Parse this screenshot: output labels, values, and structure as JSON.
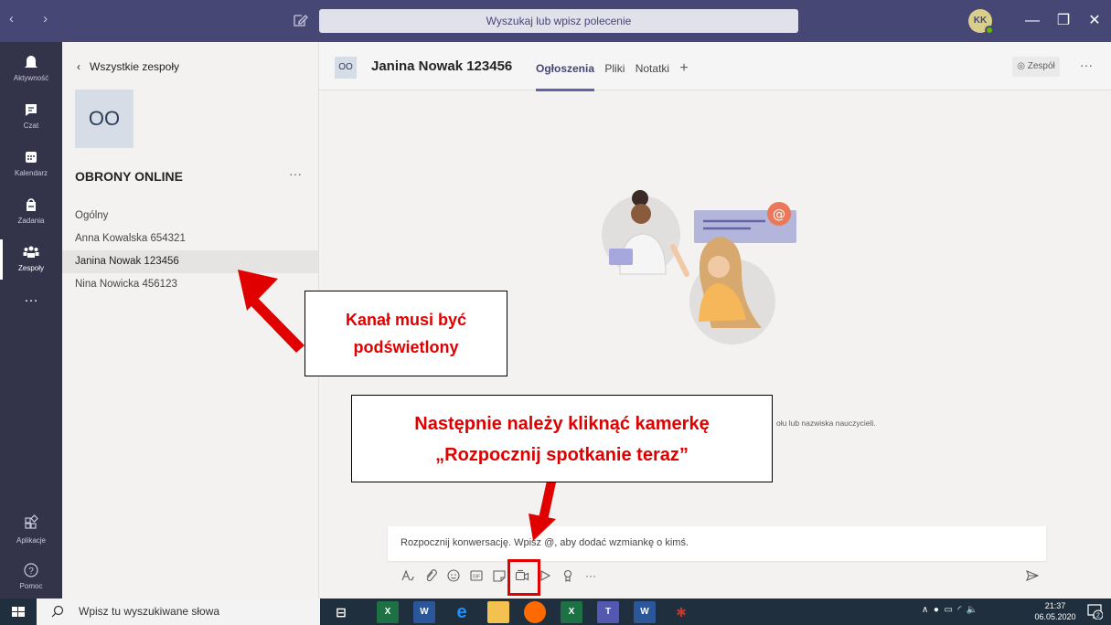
{
  "titlebar": {
    "nav_arrows": "‹  ›",
    "search_placeholder": "Wyszukaj lub wpisz polecenie",
    "avatar_initials": "KK",
    "minimize": "—",
    "restore": "❐",
    "close": "✕"
  },
  "rail": {
    "items": [
      {
        "label": "Aktywność",
        "icon": "bell-icon"
      },
      {
        "label": "Czat",
        "icon": "chat-icon"
      },
      {
        "label": "Kalendarz",
        "icon": "calendar-icon"
      },
      {
        "label": "Zadania",
        "icon": "assignments-icon"
      },
      {
        "label": "Zespoły",
        "icon": "teams-icon"
      },
      {
        "label": "…",
        "icon": "more-icon"
      }
    ],
    "bottom": [
      {
        "label": "Aplikacje",
        "icon": "apps-icon"
      },
      {
        "label": "Pomoc",
        "icon": "help-icon"
      }
    ]
  },
  "sidebar": {
    "back_label": "Wszystkie zespoły",
    "team_initials": "OO",
    "team_name": "OBRONY ONLINE",
    "more": "···",
    "channels": [
      "Ogólny",
      "Anna Kowalska 654321",
      "Janina Nowak 123456",
      "Nina Nowicka 456123"
    ],
    "selected_channel": "Janina Nowak 123456"
  },
  "header": {
    "tile_initials": "OO",
    "title": "Janina Nowak 123456",
    "tabs": [
      "Ogłoszenia",
      "Pliki",
      "Notatki"
    ],
    "active_tab": "Ogłoszenia",
    "add_tab": "+",
    "team_button": "◎ Zespół",
    "more": "···"
  },
  "main": {
    "empty_text": "ołu lub nazwiska nauczycieli.",
    "compose_placeholder": "Rozpocznij konwersację. Wpisz @, aby dodać wzmiankę o kimś.",
    "tools": [
      "format-icon",
      "attach-icon",
      "emoji-icon",
      "gif-icon",
      "sticker-icon",
      "meet-now-icon",
      "praise-icon",
      "stream-icon",
      "more-icon"
    ]
  },
  "annotations": {
    "callout_1_line_1": "Kanał musi być",
    "callout_1_line_2": "podświetlony",
    "callout_2_line_1": "Następnie należy kliknąć kamerkę",
    "callout_2_line_2": "„Rozpocznij spotkanie teraz”",
    "color": "#e00000"
  },
  "taskbar": {
    "search_placeholder": "Wpisz tu wyszukiwane słowa",
    "time": "21:37",
    "date": "06.05.2020",
    "notif_count": "2"
  },
  "colors": {
    "titlebar": "#464775",
    "rail": "#33344a",
    "accent": "#6264a7"
  }
}
